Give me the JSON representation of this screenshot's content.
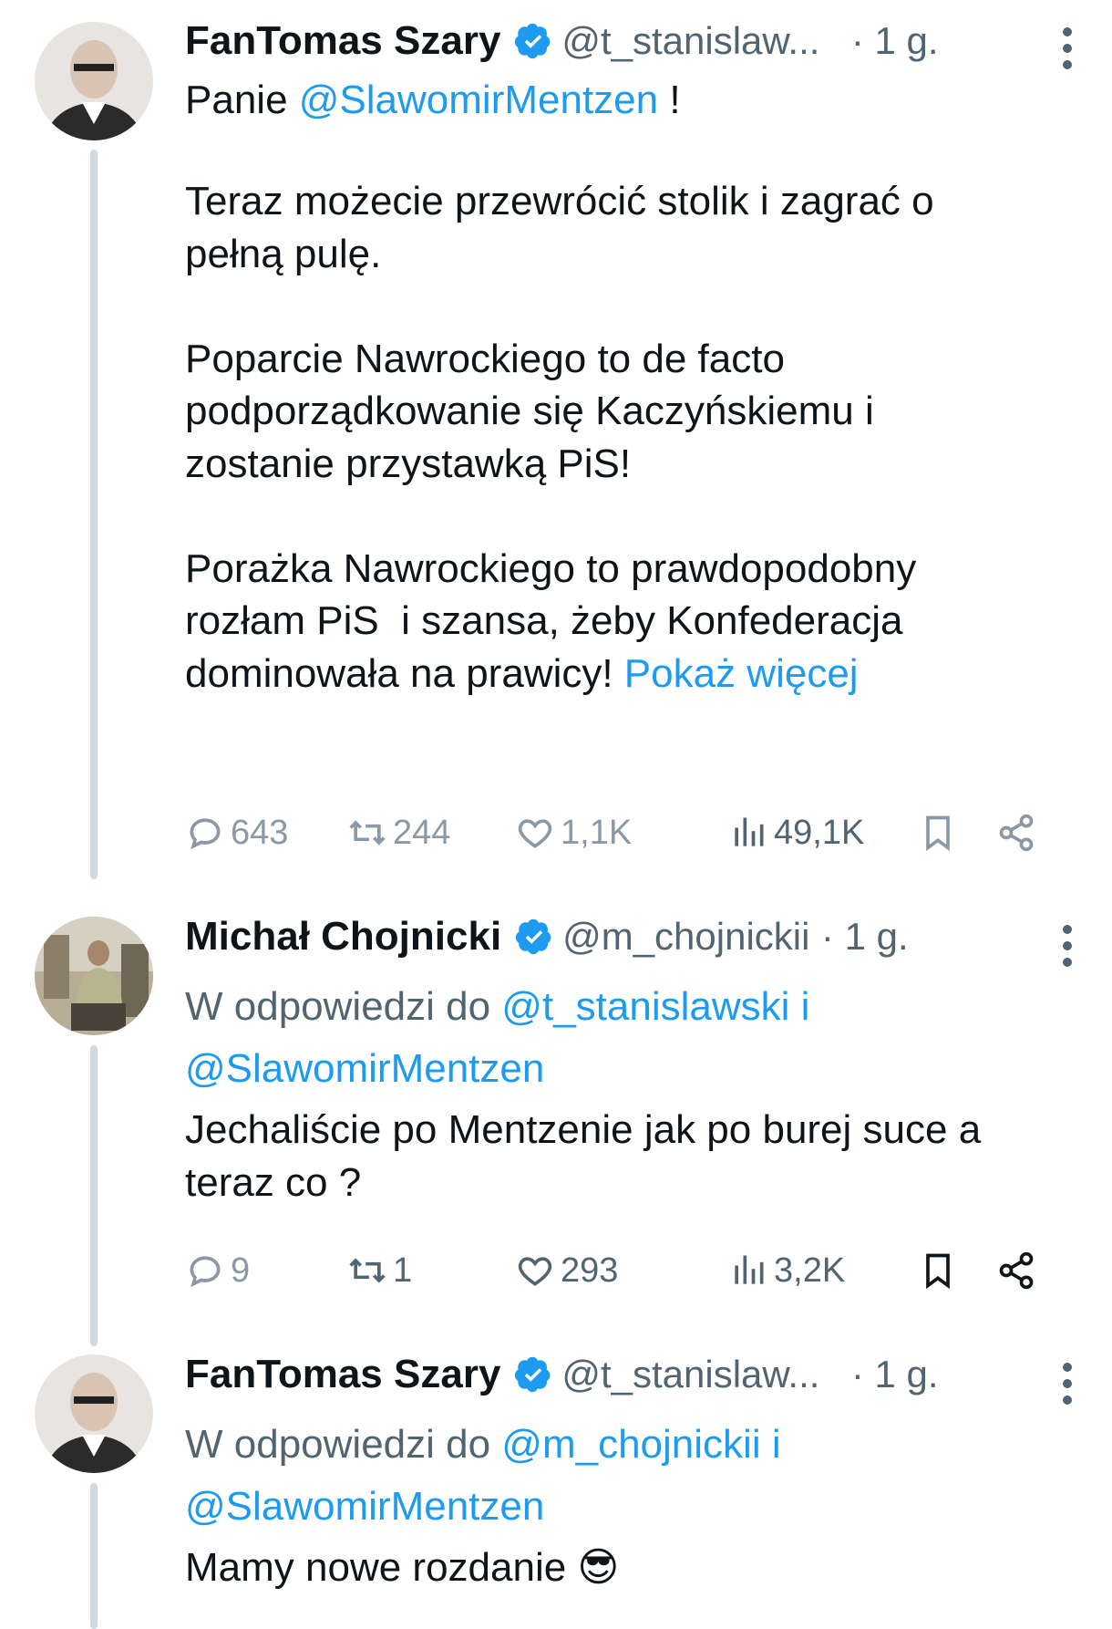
{
  "tweets": [
    {
      "author": "FanTomas Szary",
      "handle": "@t_stanislaw...",
      "time": "· 1 g.",
      "mention_prefix": "Panie ",
      "mention": "@SlawomirMentzen",
      "mention_suffix": " !",
      "body": "Teraz możecie przewrócić stolik i zagrać o\npełną pulę.\n\nPoparcie Nawrockiego to de facto\npodporządkowanie się Kaczyńskiemu i\nzostanie przystawką PiS!\n\nPorażka Nawrockiego to prawdopodobny\nrozłam PiS  i szansa, żeby Konfederacja\ndominowała na prawicy! ",
      "show_more": "Pokaż więcej",
      "replies": "643",
      "retweets": "244",
      "likes": "1,1K",
      "views": "49,1K"
    },
    {
      "author": "Michał Chojnicki",
      "handle": "@m_chojnickii",
      "time": "· 1 g.",
      "reply_prefix": "W odpowiedzi do ",
      "reply_user1": "@t_stanislawski i",
      "reply_user2": "@SlawomirMentzen",
      "body": "Jechaliście po Mentzenie jak po burej suce a\nteraz co ?",
      "replies": "9",
      "retweets": "1",
      "likes": "293",
      "views": "3,2K"
    },
    {
      "author": "FanTomas Szary",
      "handle": "@t_stanislaw...",
      "time": "· 1 g.",
      "reply_prefix": "W odpowiedzi do ",
      "reply_user1": "@m_chojnickii i",
      "reply_user2": "@SlawomirMentzen",
      "body": "Mamy nowe rozdanie 😎"
    }
  ],
  "colors": {
    "accent": "#1d9bf0",
    "muted": "#536471",
    "line": "#cfd9de"
  },
  "icons": [
    "verified-badge-icon",
    "more-icon",
    "reply-icon",
    "retweet-icon",
    "like-icon",
    "views-icon",
    "bookmark-icon",
    "share-icon"
  ]
}
